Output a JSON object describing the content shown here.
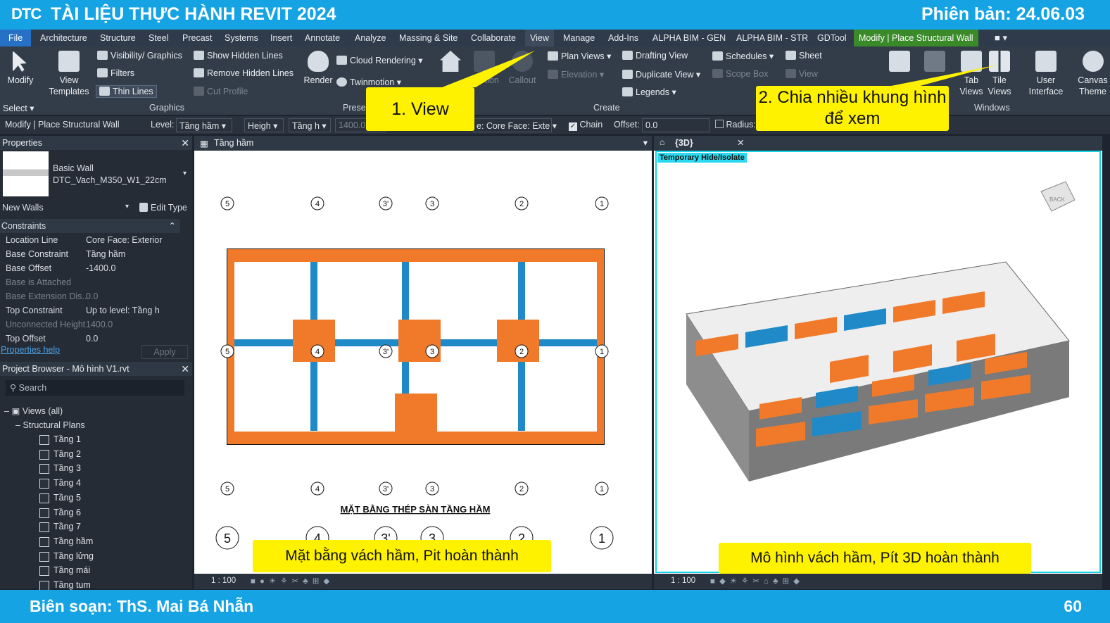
{
  "slide": {
    "logo": "DTC",
    "title": "TÀI LIỆU THỰC HÀNH REVIT 2024",
    "version": "Phiên bản: 24.06.03",
    "footer_author": "Biên soạn: ThS. Mai Bá Nhẫn",
    "page_number": "60"
  },
  "menu": [
    "File",
    "Architecture",
    "Structure",
    "Steel",
    "Precast",
    "Systems",
    "Insert",
    "Annotate",
    "Analyze",
    "Massing & Site",
    "Collaborate",
    "View",
    "Manage",
    "Add-Ins",
    "ALPHA BIM - GEN",
    "ALPHA BIM - STR",
    "GDTool",
    "Modify | Place Structural Wall"
  ],
  "ribbon": {
    "modify": "Modify",
    "select": "Select",
    "view_templates": "View Templates",
    "visibility_graphics": "Visibility/ Graphics",
    "filters": "Filters",
    "thin_lines": "Thin Lines",
    "show_hidden_lines": "Show Hidden Lines",
    "remove_hidden_lines": "Remove Hidden Lines",
    "cut_profile": "Cut Profile",
    "graphics_group": "Graphics",
    "render": "Render",
    "cloud_rendering": "Cloud Rendering",
    "twinmotion": "Twinmotion",
    "presentation_group": "Prese",
    "section": "Section",
    "callout": "Callout",
    "plan_views": "Plan Views",
    "elevation": "Elevation",
    "drafting_view": "Drafting View",
    "duplicate_view": "Duplicate View",
    "legends": "Legends",
    "schedules": "Schedules",
    "scope_box": "Scope Box",
    "sheet": "Sheet",
    "view": "View",
    "create_group": "Create",
    "tab_views": "Tab Views",
    "tile_views": "Tile Views",
    "windows_group": "Windows",
    "user_interface": "User Interface",
    "canvas_theme": "Canvas Theme"
  },
  "options": {
    "context": "Modify | Place Structural Wall",
    "level_label": "Level:",
    "level_value": "Tầng hầm",
    "height_value": "Heigh",
    "top_value": "Tầng h",
    "height_input": "1400.0",
    "location_line": "e: Core Face: Exte",
    "chain": "Chain",
    "offset_label": "Offset:",
    "offset_value": "0.0",
    "radius": "Radius:"
  },
  "properties": {
    "title": "Properties",
    "family": "Basic Wall",
    "type": "DTC_Vach_M350_W1_22cm",
    "new_label": "New Walls",
    "edit_type": "Edit Type",
    "section": "Constraints",
    "rows": [
      {
        "k": "Location Line",
        "v": "Core Face: Exterior",
        "dis": false
      },
      {
        "k": "Base Constraint",
        "v": "Tầng hầm",
        "dis": false
      },
      {
        "k": "Base Offset",
        "v": "-1400.0",
        "dis": false
      },
      {
        "k": "Base is Attached",
        "v": "",
        "dis": true
      },
      {
        "k": "Base Extension Dis...",
        "v": "0.0",
        "dis": true
      },
      {
        "k": "Top Constraint",
        "v": "Up to level: Tầng h",
        "dis": false
      },
      {
        "k": "Unconnected Height",
        "v": "1400.0",
        "dis": true
      },
      {
        "k": "Top Offset",
        "v": "0.0",
        "dis": false
      }
    ],
    "help": "Properties help",
    "apply": "Apply"
  },
  "browser": {
    "title": "Project Browser - Mô hình V1.rvt",
    "search": "Search",
    "views": "Views (all)",
    "structural_plans": "Structural Plans",
    "items": [
      "Tầng 1",
      "Tầng 2",
      "Tầng 3",
      "Tầng 4",
      "Tầng 5",
      "Tầng 6",
      "Tầng 7",
      "Tầng hầm",
      "Tầng lửng",
      "Tầng mái",
      "Tầng tum"
    ]
  },
  "view_plan": {
    "tab": "Tầng hầm",
    "drawing_title": "MẶT BẰNG THÉP SÀN TẦNG HẦM",
    "grid_labels": [
      "5",
      "4",
      "3'",
      "3",
      "2",
      "1"
    ],
    "scale": "1 : 100"
  },
  "view_3d": {
    "tab": "{3D}",
    "temp_hide": "Temporary Hide/Isolate",
    "scale": "1 : 100",
    "cube_back": "BACK"
  },
  "callouts": {
    "c1": "1. View",
    "c2": "2. Chia nhiều khung hình để xem",
    "c3": "Mặt bằng vách hầm, Pit hoàn thành",
    "c4": "Mô hình vách hầm, Pít 3D hoàn thành"
  },
  "colors": {
    "brand": "#15a3e3",
    "callout": "#fef200",
    "wall_orange": "#f07a2a",
    "wall_blue": "#1f8ac7"
  }
}
